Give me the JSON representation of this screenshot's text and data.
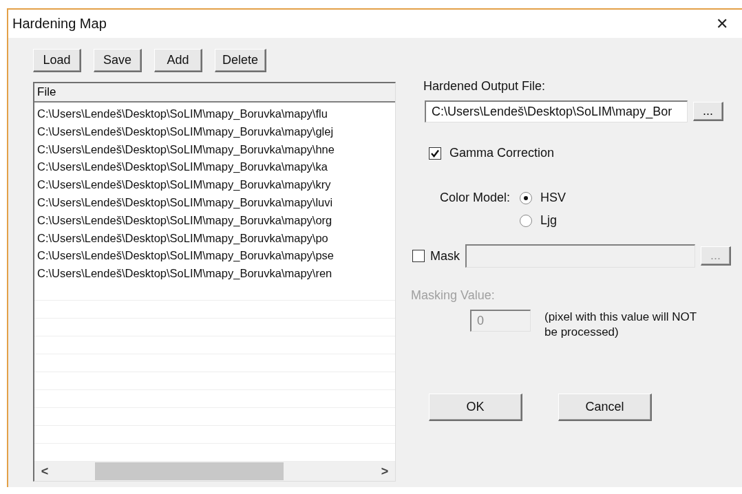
{
  "window": {
    "title": "Hardening Map",
    "close": "✕"
  },
  "toolbar": [
    "Load",
    "Save",
    "Add",
    "Delete"
  ],
  "file_list": {
    "column": "File",
    "rows": [
      "C:\\Users\\Lendeš\\Desktop\\SoLIM\\mapy_Boruvka\\mapy\\flu",
      "C:\\Users\\Lendeš\\Desktop\\SoLIM\\mapy_Boruvka\\mapy\\glej",
      "C:\\Users\\Lendeš\\Desktop\\SoLIM\\mapy_Boruvka\\mapy\\hne",
      "C:\\Users\\Lendeš\\Desktop\\SoLIM\\mapy_Boruvka\\mapy\\ka",
      "C:\\Users\\Lendeš\\Desktop\\SoLIM\\mapy_Boruvka\\mapy\\kry",
      "C:\\Users\\Lendeš\\Desktop\\SoLIM\\mapy_Boruvka\\mapy\\luvi",
      "C:\\Users\\Lendeš\\Desktop\\SoLIM\\mapy_Boruvka\\mapy\\org",
      "C:\\Users\\Lendeš\\Desktop\\SoLIM\\mapy_Boruvka\\mapy\\po",
      "C:\\Users\\Lendeš\\Desktop\\SoLIM\\mapy_Boruvka\\mapy\\pse",
      "C:\\Users\\Lendeš\\Desktop\\SoLIM\\mapy_Boruvka\\mapy\\ren"
    ],
    "scroll_left": "<",
    "scroll_right": ">"
  },
  "output": {
    "label": "Hardened Output File:",
    "value": "C:\\Users\\Lendeš\\Desktop\\SoLIM\\mapy_Bor",
    "browse": "..."
  },
  "gamma": {
    "label": "Gamma Correction",
    "checked": true
  },
  "color_model": {
    "label": "Color Model:",
    "options": [
      {
        "label": "HSV",
        "selected": true
      },
      {
        "label": "Ljg",
        "selected": false
      }
    ]
  },
  "mask": {
    "label": "Mask",
    "checked": false,
    "disabled": true,
    "browse": "..."
  },
  "masking_value": {
    "label": "Masking Value:",
    "value": "0",
    "disabled": true,
    "note": "(pixel with this value will NOT be processed)"
  },
  "buttons": [
    "OK",
    "Cancel"
  ]
}
